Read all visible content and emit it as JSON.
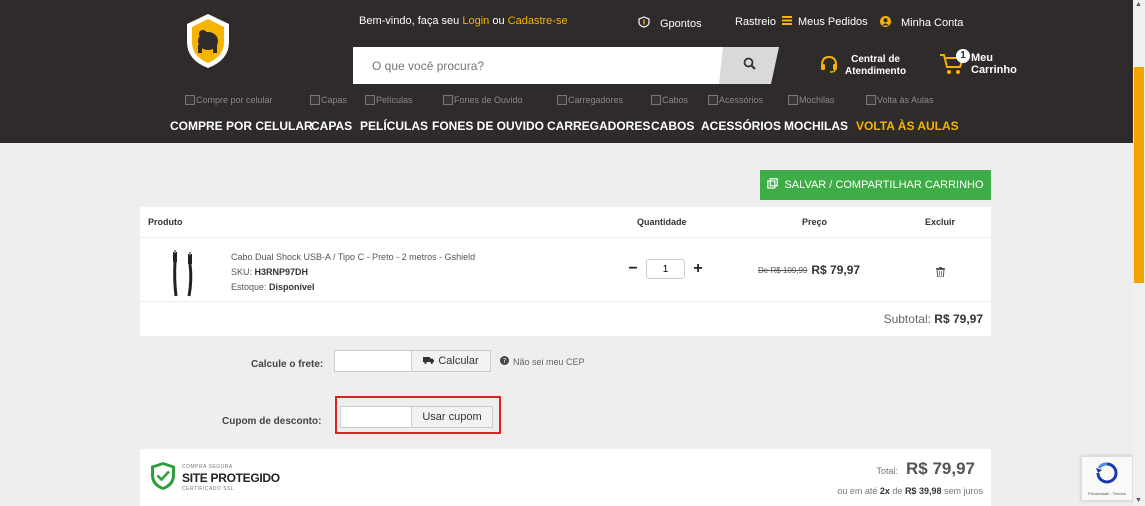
{
  "header": {
    "welcome_prefix": "Bem-vindo, faça seu",
    "login": "Login",
    "or": "ou",
    "register": "Cadastre-se",
    "gpontos": "Gpontos",
    "rastreio": "Rastreio",
    "meus_pedidos": "Meus Pedidos",
    "minha_conta": "Minha Conta",
    "central_line1": "Central de",
    "central_line2": "Atendimento",
    "cart_count": "1",
    "cart_line1": "Meu",
    "cart_line2": "Carrinho",
    "accent_color": "#f5b400",
    "background_color": "#2f2b2a"
  },
  "search": {
    "placeholder": "O que você procura?"
  },
  "category_images": [
    "Compre por celular",
    "Capas",
    "Películas",
    "Fones de Ouvido",
    "Carregadores",
    "Cabos",
    "Acessórios",
    "Mochilas",
    "Volta às Aulas"
  ],
  "category_nav": [
    "COMPRE POR CELULAR",
    "CAPAS",
    "PELÍCULAS",
    "FONES DE OUVIDO",
    "CARREGADORES",
    "CABOS",
    "ACESSÓRIOS",
    "MOCHILAS",
    "VOLTA ÀS AULAS"
  ],
  "save_button": "SALVAR / COMPARTILHAR CARRINHO",
  "table": {
    "headers": {
      "produto": "Produto",
      "quantidade": "Quantidade",
      "preco": "Preço",
      "excluir": "Excluir"
    },
    "item": {
      "name": "Cabo Dual Shock USB-A / Tipo C - Preto - 2 metros - Gshield",
      "sku_label": "SKU:",
      "sku": "H3RNP97DH",
      "stock_label": "Estoque:",
      "stock": "Disponível",
      "quantity": "1",
      "old_price": "De R$ 109,99",
      "price": "R$ 79,97"
    },
    "subtotal_label": "Subtotal:",
    "subtotal": "R$ 79,97"
  },
  "shipping": {
    "label": "Calcule o frete:",
    "button": "Calcular",
    "help": "Não sei meu CEP"
  },
  "coupon": {
    "label": "Cupom de desconto:",
    "button": "Usar cupom"
  },
  "seal": {
    "small_top": "COMPRA SEGURA",
    "title": "SITE PROTEGIDO",
    "small_bottom": "CERTIFICADO SSL"
  },
  "summary": {
    "total_label": "Total:",
    "total": "R$ 79,97",
    "inst_prefix": "ou em até",
    "inst_times": "2x",
    "inst_de": "de",
    "inst_value": "R$ 39,98",
    "inst_suffix": "sem juros"
  },
  "recaptcha": {
    "text": "Privacidade - Termos"
  },
  "colors": {
    "green": "#3fad47",
    "highlight_red": "#e02020",
    "scroll_orange": "#f5a300"
  }
}
